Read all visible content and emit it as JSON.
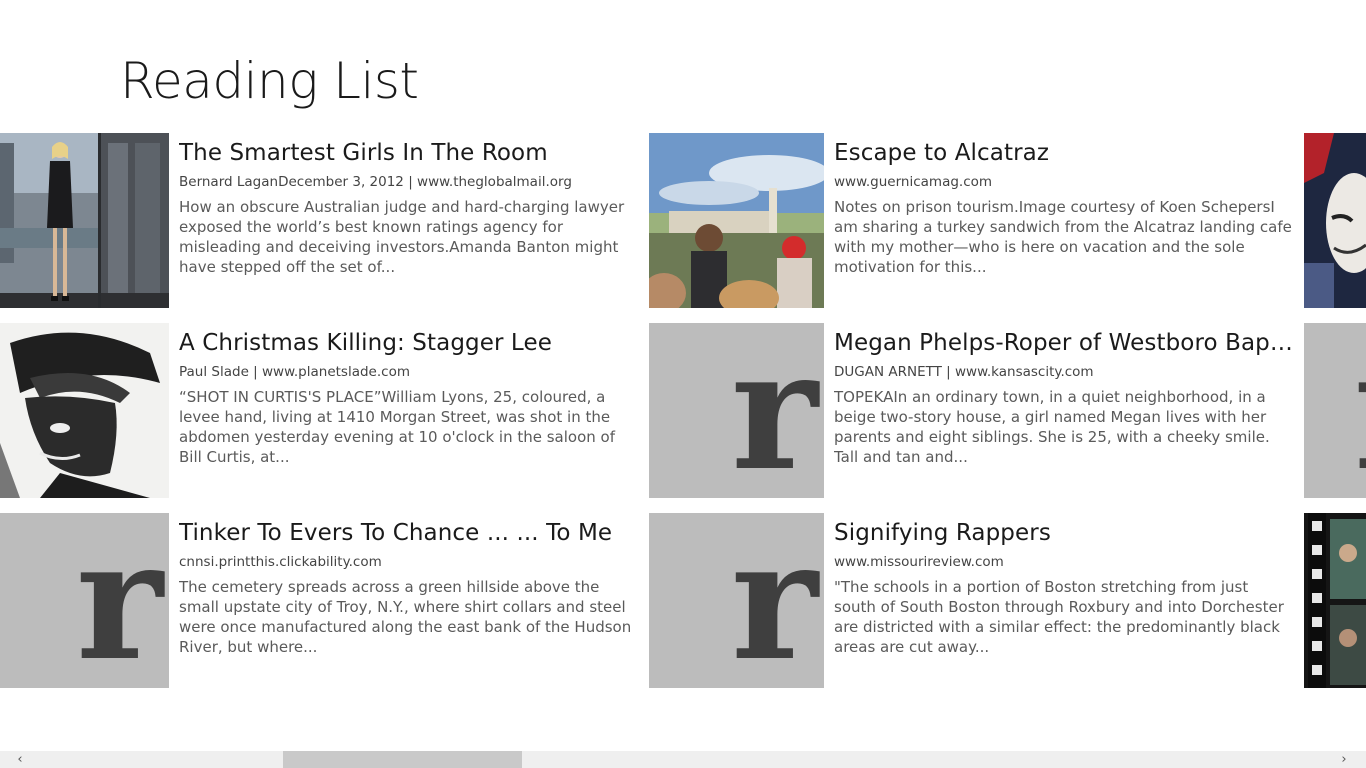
{
  "page": {
    "title": "Reading List"
  },
  "articles": [
    {
      "title": "The Smartest Girls In The Room",
      "meta": "Bernard LaganDecember 3, 2012 | www.theglobalmail.org",
      "snippet": "How an obscure Australian judge and hard-charging lawyer exposed the world’s best known ratings agency for misleading and deceiving investors.Amanda Banton might have stepped off the set of..."
    },
    {
      "title": "Escape to Alcatraz",
      "meta": "www.guernicamag.com",
      "snippet": "Notes on prison tourism.Image courtesy of Koen SchepersI am sharing a turkey sandwich from the Alcatraz landing cafe with my mother—who is here on vacation and the sole motivation for this..."
    },
    {
      "title": "A Christmas Killing: Stagger Lee",
      "meta": "Paul Slade | www.planetslade.com",
      "snippet": "“SHOT IN CURTIS'S PLACE”William Lyons, 25, coloured, a levee hand, living at 1410 Morgan Street, was shot in the abdomen yesterday evening at 10 o'clock in the saloon of Bill Curtis, at..."
    },
    {
      "title": "Megan Phelps-Roper of Westboro Bapt...",
      "meta": "DUGAN ARNETT | www.kansascity.com",
      "snippet": "TOPEKAIn an ordinary town, in a quiet neighborhood, in a beige two-story house, a girl named Megan lives with her parents and eight siblings. She is 25, with a cheeky smile. Tall and tan and..."
    },
    {
      "title": "Tinker To Evers To Chance ... ... To Me",
      "meta": "cnnsi.printthis.clickability.com",
      "snippet": "The cemetery spreads across a green hillside above the small upstate city of Troy, N.Y., where shirt collars and steel were once manufactured along the east bank of the Hudson River, but where..."
    },
    {
      "title": "Signifying Rappers",
      "meta": "www.missourireview.com",
      "snippet": "\"The schools in a portion of Boston stretching from just south of South Boston through Roxbury and into Dorchester are districted with a similar effect: the predominantly black areas are cut away..."
    }
  ],
  "placeholder_letter": "r",
  "icons": {
    "scroll_left": "‹",
    "scroll_right": "›"
  },
  "colors": {
    "placeholder_bg": "#bcbcbc",
    "placeholder_letter": "#3f3f3f"
  }
}
